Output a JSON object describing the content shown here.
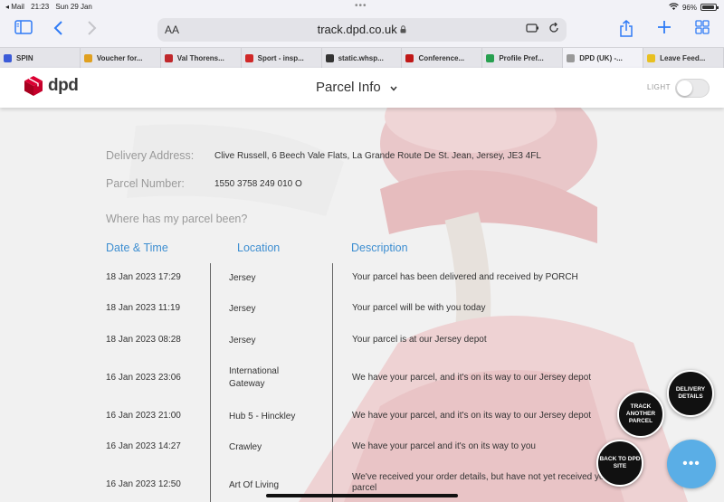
{
  "status_bar": {
    "back_app": "◂ Mail",
    "time": "21:23",
    "date": "Sun 29 Jan",
    "dots": "•••",
    "battery": "96%"
  },
  "browser": {
    "aa_label": "AA",
    "url": "track.dpd.co.uk",
    "tabs": [
      {
        "label": "SPIN",
        "color": "#3b5bd8"
      },
      {
        "label": "Voucher for...",
        "color": "#e0a020"
      },
      {
        "label": "Val Thorens...",
        "color": "#c0282c"
      },
      {
        "label": "Sport - insp...",
        "color": "#d02828"
      },
      {
        "label": "static.whsp...",
        "color": "#333333"
      },
      {
        "label": "Conference...",
        "color": "#c01818"
      },
      {
        "label": "Profile Pref...",
        "color": "#28a050"
      },
      {
        "label": "DPD (UK) -...",
        "color": "#999999"
      },
      {
        "label": "Leave Feed...",
        "color": "#e8c020"
      }
    ]
  },
  "header": {
    "logo_text": "dpd",
    "title": "Parcel Info",
    "light_label": "LIGHT",
    "brand_color": "#dc0032"
  },
  "delivery": {
    "address_label": "Delivery Address:",
    "address_value": "Clive Russell, 6 Beech Vale Flats, La Grande Route De St. Jean, Jersey, JE3 4FL",
    "parcel_label": "Parcel Number:",
    "parcel_value": "1550 3758 249 010 O",
    "where_label": "Where has my parcel been?"
  },
  "table": {
    "headers": {
      "date": "Date & Time",
      "location": "Location",
      "description": "Description"
    },
    "rows": [
      {
        "date": "18 Jan 2023 17:29",
        "location": "Jersey",
        "description": "Your parcel has been delivered and received by PORCH"
      },
      {
        "date": "18 Jan 2023 11:19",
        "location": "Jersey",
        "description": "Your parcel will be with you today"
      },
      {
        "date": "18 Jan 2023 08:28",
        "location": "Jersey",
        "description": "Your parcel is at our Jersey depot"
      },
      {
        "date": "16 Jan 2023 23:06",
        "location": "International Gateway",
        "description": "We have your parcel, and it's on its way to our Jersey depot"
      },
      {
        "date": "16 Jan 2023 21:00",
        "location": "Hub 5 - Hinckley",
        "description": "We have your parcel, and it's on its way to our Jersey depot"
      },
      {
        "date": "16 Jan 2023 14:27",
        "location": "Crawley",
        "description": "We have your parcel and it's on its way to you"
      },
      {
        "date": "16 Jan 2023 12:50",
        "location": "Art Of Living",
        "description": "We've received your order details, but have not yet received your parcel"
      }
    ]
  },
  "fabs": {
    "delivery_details": "DELIVERY DETAILS",
    "track_another": "TRACK ANOTHER PARCEL",
    "back_to_site": "BACK TO DPD SITE",
    "more": "•••"
  }
}
